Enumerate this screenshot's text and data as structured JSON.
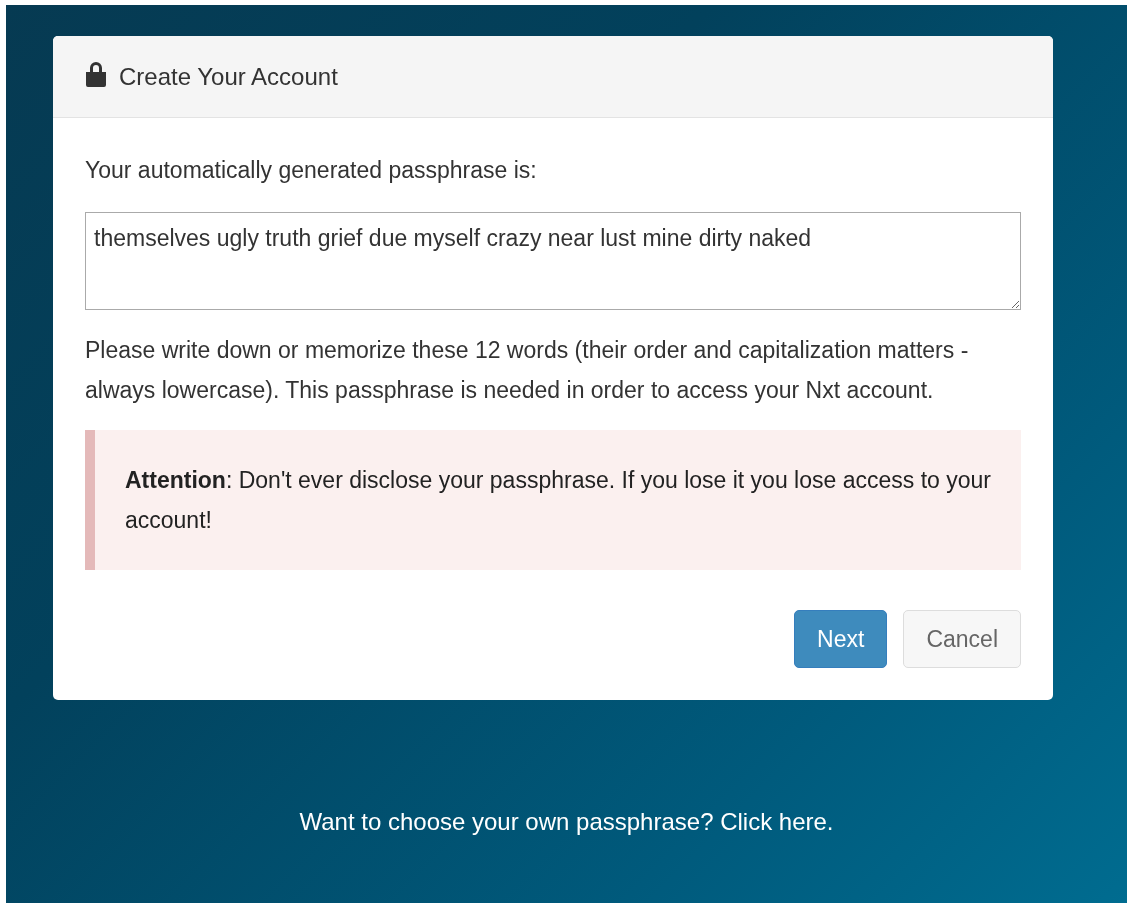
{
  "dialog": {
    "title": "Create Your Account",
    "intro": "Your automatically generated passphrase is:",
    "passphrase": "themselves ugly truth grief due myself crazy near lust mine dirty naked",
    "instructions": "Please write down or memorize these 12 words (their order and capitalization matters - always lowercase). This passphrase is needed in order to access your Nxt account.",
    "alert": "**Attention**: Don't ever disclose your passphrase. If you lose it you lose access to your account!",
    "buttons": [
      {
        "label": "Next",
        "kind": "primary"
      },
      {
        "label": "Cancel",
        "kind": "default"
      }
    ]
  },
  "footer": {
    "text": "Want to choose your own passphrase?",
    "link": "Click here."
  }
}
